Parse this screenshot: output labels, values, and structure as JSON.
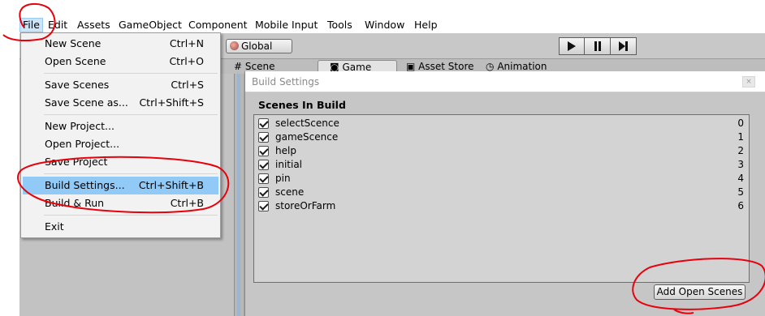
{
  "menubar": {
    "items": [
      "File",
      "Edit",
      "Assets",
      "GameObject",
      "Component",
      "Mobile Input",
      "Tools",
      "Window",
      "Help"
    ]
  },
  "file_menu": {
    "items": [
      {
        "label": "New Scene",
        "shortcut": "Ctrl+N"
      },
      {
        "label": "Open Scene",
        "shortcut": "Ctrl+O"
      },
      {
        "label": "Save Scenes",
        "shortcut": "Ctrl+S"
      },
      {
        "label": "Save Scene as...",
        "shortcut": "Ctrl+Shift+S"
      },
      {
        "label": "New Project...",
        "shortcut": ""
      },
      {
        "label": "Open Project...",
        "shortcut": ""
      },
      {
        "label": "Save Project",
        "shortcut": ""
      },
      {
        "label": "Build Settings...",
        "shortcut": "Ctrl+Shift+B"
      },
      {
        "label": "Build & Run",
        "shortcut": "Ctrl+B"
      },
      {
        "label": "Exit",
        "shortcut": ""
      }
    ]
  },
  "toolbar": {
    "global_label": "Global",
    "play_icon": "play-icon",
    "pause_icon": "pause-icon",
    "step_icon": "step-icon"
  },
  "tabs": {
    "scene": "Scene",
    "game": "Game",
    "asset_store": "Asset Store",
    "animation": "Animation"
  },
  "build_settings": {
    "title": "Build Settings",
    "heading": "Scenes In Build",
    "scenes": [
      {
        "name": "selectScence",
        "index": "0",
        "checked": true
      },
      {
        "name": "gameScence",
        "index": "1",
        "checked": true
      },
      {
        "name": "help",
        "index": "2",
        "checked": true
      },
      {
        "name": "initial",
        "index": "3",
        "checked": true
      },
      {
        "name": "pin",
        "index": "4",
        "checked": true
      },
      {
        "name": "scene",
        "index": "5",
        "checked": true
      },
      {
        "name": "storeOrFarm",
        "index": "6",
        "checked": true
      }
    ],
    "add_open_scenes": "Add Open Scenes"
  },
  "colors": {
    "highlight": "#91c9f7",
    "annotation": "#e8000b"
  }
}
